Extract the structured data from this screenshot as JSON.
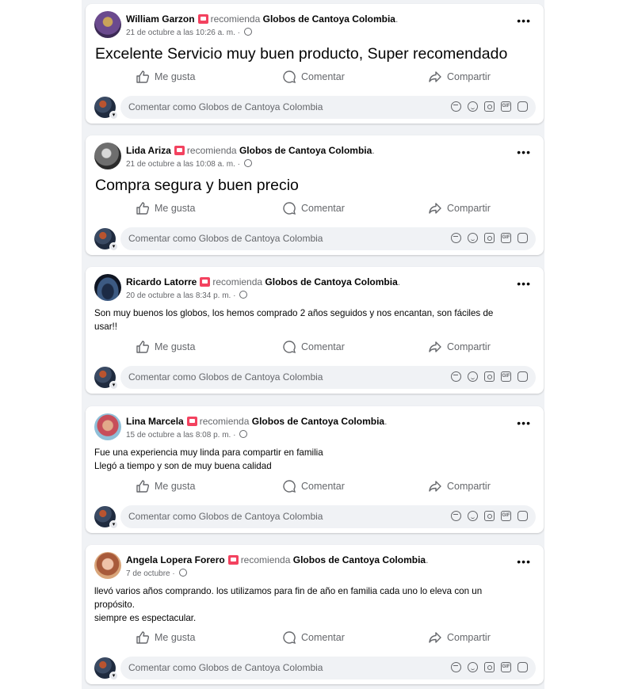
{
  "recommend_word": "recomienda",
  "page_name": "Globos de Cantoya Colombia",
  "actions": {
    "like": "Me gusta",
    "comment": "Comentar",
    "share": "Compartir"
  },
  "comment_placeholder": "Comentar como Globos de Cantoya Colombia",
  "more_glyph": "•••",
  "icons": [
    "like-icon",
    "comment-icon",
    "share-icon",
    "avatar-sticker-icon",
    "emoji-icon",
    "camera-icon",
    "gif-icon",
    "sticker-icon",
    "globe-icon",
    "recommend-icon"
  ],
  "colors": {
    "recommend": "#f3425f",
    "secondary_text": "#65676b",
    "feed_bg": "#f0f2f5"
  },
  "posts": [
    {
      "author": "William Garzon",
      "date": "21 de octubre a las 10:26 a. m.",
      "lines": [
        "Excelente Servicio muy buen producto, Super recomendado"
      ]
    },
    {
      "author": "Lida Ariza",
      "date": "21 de octubre a las 10:08 a. m.",
      "lines": [
        "Compra segura y buen precio"
      ]
    },
    {
      "author": "Ricardo Latorre",
      "date": "20 de octubre a las 8:34 p. m.",
      "lines": [
        "Son muy buenos los globos, los hemos comprado 2 años seguidos y nos encantan, son fáciles de",
        "usar!!"
      ]
    },
    {
      "author": "Lina Marcela",
      "date": "15 de octubre a las 8:08 p. m.",
      "lines": [
        "Fue una experiencia muy linda para compartir en familia",
        "Llegó a tiempo y son de muy buena calidad"
      ]
    },
    {
      "author": "Angela Lopera Forero",
      "date": "7 de octubre",
      "lines": [
        "llevó varios años comprando. los utilizamos para fin de año en familia cada uno lo eleva con un",
        "propósito.",
        "siempre es espectacular."
      ]
    }
  ]
}
